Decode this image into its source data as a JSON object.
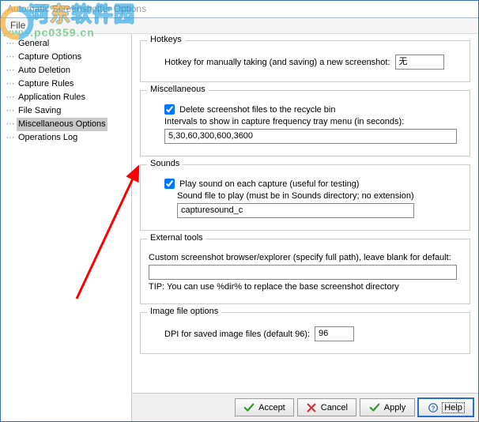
{
  "window": {
    "title": "Automatic Screenshotter Options",
    "menu": {
      "file": "File"
    }
  },
  "watermark": {
    "line1_a": "河",
    "line1_b": "东",
    "line1_c": "软件园",
    "line2": "www.pc0359.cn"
  },
  "sidebar": {
    "items": [
      {
        "label": "General"
      },
      {
        "label": "Capture Options"
      },
      {
        "label": "Auto Deletion"
      },
      {
        "label": "Capture Rules"
      },
      {
        "label": "Application Rules"
      },
      {
        "label": "File Saving"
      },
      {
        "label": "Miscellaneous Options"
      },
      {
        "label": "Operations Log"
      }
    ]
  },
  "hotkeys": {
    "legend": "Hotkeys",
    "label": "Hotkey for manually taking (and saving) a new screenshot:",
    "value": "无"
  },
  "misc": {
    "legend": "Miscellaneous",
    "delete_recycle": "Delete screenshot files to the recycle bin",
    "intervals_label": "Intervals to show in capture frequency tray menu (in seconds):",
    "intervals_value": "5,30,60,300,600,3600"
  },
  "sounds": {
    "legend": "Sounds",
    "play_sound": "Play sound on each capture (useful for testing)",
    "file_label": "Sound file to play (must be in Sounds directory; no extension)",
    "file_value": "capturesound_c"
  },
  "external": {
    "legend": "External tools",
    "browser_label": "Custom screenshot browser/explorer (specify full path), leave blank for default:",
    "browser_value": "",
    "tip": "TIP: You can use %dir% to replace the base screenshot directory"
  },
  "image": {
    "legend": "Image file options",
    "dpi_label": "DPI for saved image files (default 96):",
    "dpi_value": "96"
  },
  "buttons": {
    "accept": "Accept",
    "cancel": "Cancel",
    "apply": "Apply",
    "help": "Help"
  }
}
